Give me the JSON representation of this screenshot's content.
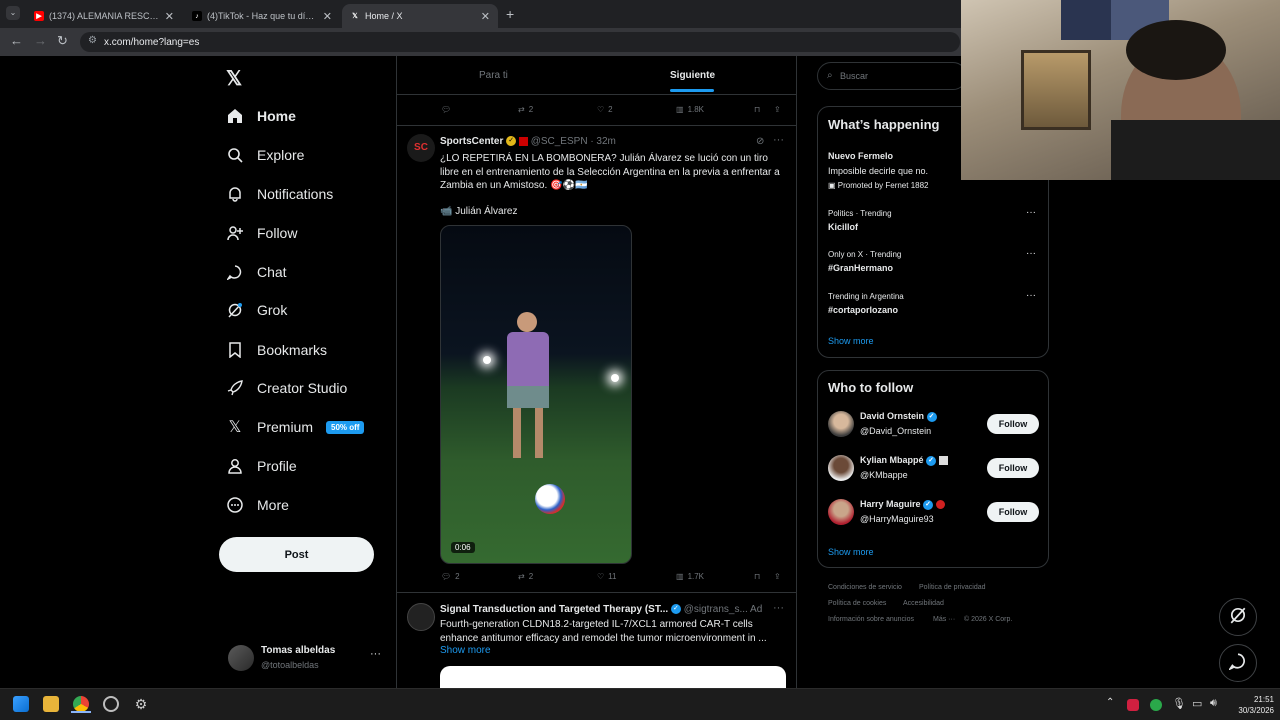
{
  "browser": {
    "tabs": [
      {
        "title": "(1374) ALEMANIA RESCATÓ UN",
        "icon": "youtube-icon"
      },
      {
        "title": "(4)TikTok - Haz que tu día sea",
        "icon": "tiktok-icon"
      },
      {
        "title": "Home / X",
        "icon": "x-icon"
      }
    ],
    "url": "x.com/home?lang=es"
  },
  "sidebar": {
    "items": [
      {
        "label": "Home",
        "icon": "home-icon"
      },
      {
        "label": "Explore",
        "icon": "search-icon"
      },
      {
        "label": "Notifications",
        "icon": "bell-icon"
      },
      {
        "label": "Follow",
        "icon": "follow-icon"
      },
      {
        "label": "Chat",
        "icon": "chat-icon"
      },
      {
        "label": "Grok",
        "icon": "grok-icon"
      },
      {
        "label": "Bookmarks",
        "icon": "bookmark-icon"
      },
      {
        "label": "Creator Studio",
        "icon": "rocket-icon"
      },
      {
        "label": "Premium",
        "icon": "x-icon"
      },
      {
        "label": "Profile",
        "icon": "person-icon"
      },
      {
        "label": "More",
        "icon": "more-circle-icon"
      }
    ],
    "premium_badge": "50% off",
    "post_label": "Post",
    "user": {
      "name": "Tomas albeldas",
      "handle": "@totoalbeldas",
      "more": "···"
    }
  },
  "feed": {
    "tabs": [
      "Para ti",
      "Siguiente"
    ],
    "prev_actions": {
      "reposts": "2",
      "likes": "2",
      "views": "1.8K"
    },
    "post1": {
      "avatar_text": "SC",
      "name": "SportsCenter",
      "handle": "@SC_ESPN",
      "time": "· 32m",
      "text": "¿LO REPETIRÁ EN LA BOMBONERA? Julián Álvarez se lució con un tiro libre en el entrenamiento de la Selección Argentina en la previa a enfrentar a Zambia en un Amistoso. 🎯⚽🇦🇷",
      "tag": "📹 Julián Álvarez",
      "duration": "0:06",
      "actions": {
        "replies": "2",
        "reposts": "2",
        "likes": "11",
        "views": "1.7K"
      }
    },
    "post2": {
      "name": "Signal Transduction and Targeted Therapy (ST...",
      "handle": "@sigtrans_s...",
      "ad": "Ad",
      "text": "Fourth-generation CLDN18.2-targeted IL-7/XCL1 armored CAR-T cells enhance antitumor efficacy and remodel the tumor microenvironment in ...",
      "show_more": "Show more"
    }
  },
  "right": {
    "search_placeholder": "Buscar",
    "happening": {
      "title": "What’s happening",
      "promo": {
        "title": "Nuevo Fermelo",
        "sub": "Imposible decirle que no.",
        "promoted": "Promoted by Fernet 1882"
      },
      "trends": [
        {
          "meta": "Politics · Trending",
          "name": "Kicillof"
        },
        {
          "meta": "Only on X · Trending",
          "name": "#GranHermano"
        },
        {
          "meta": "Trending in Argentina",
          "name": "#cortaporlozano"
        }
      ],
      "show_more": "Show more"
    },
    "who": {
      "title": "Who to follow",
      "users": [
        {
          "name": "David Ornstein",
          "handle": "@David_Ornstein"
        },
        {
          "name": "Kylian Mbappé",
          "handle": "@KMbappe"
        },
        {
          "name": "Harry Maguire",
          "handle": "@HarryMaguire93"
        }
      ],
      "follow_label": "Follow",
      "show_more": "Show more"
    },
    "footer": [
      "Condiciones de servicio",
      "Política de privacidad",
      "Política de cookies",
      "Accesibilidad",
      "Información sobre anuncios",
      "Más ···",
      "© 2026 X Corp."
    ]
  },
  "taskbar": {
    "time": "21:51",
    "date": "30/3/2026"
  },
  "colors": {
    "accent": "#1d9bf0",
    "bg": "#000000",
    "border": "#2f3336"
  }
}
